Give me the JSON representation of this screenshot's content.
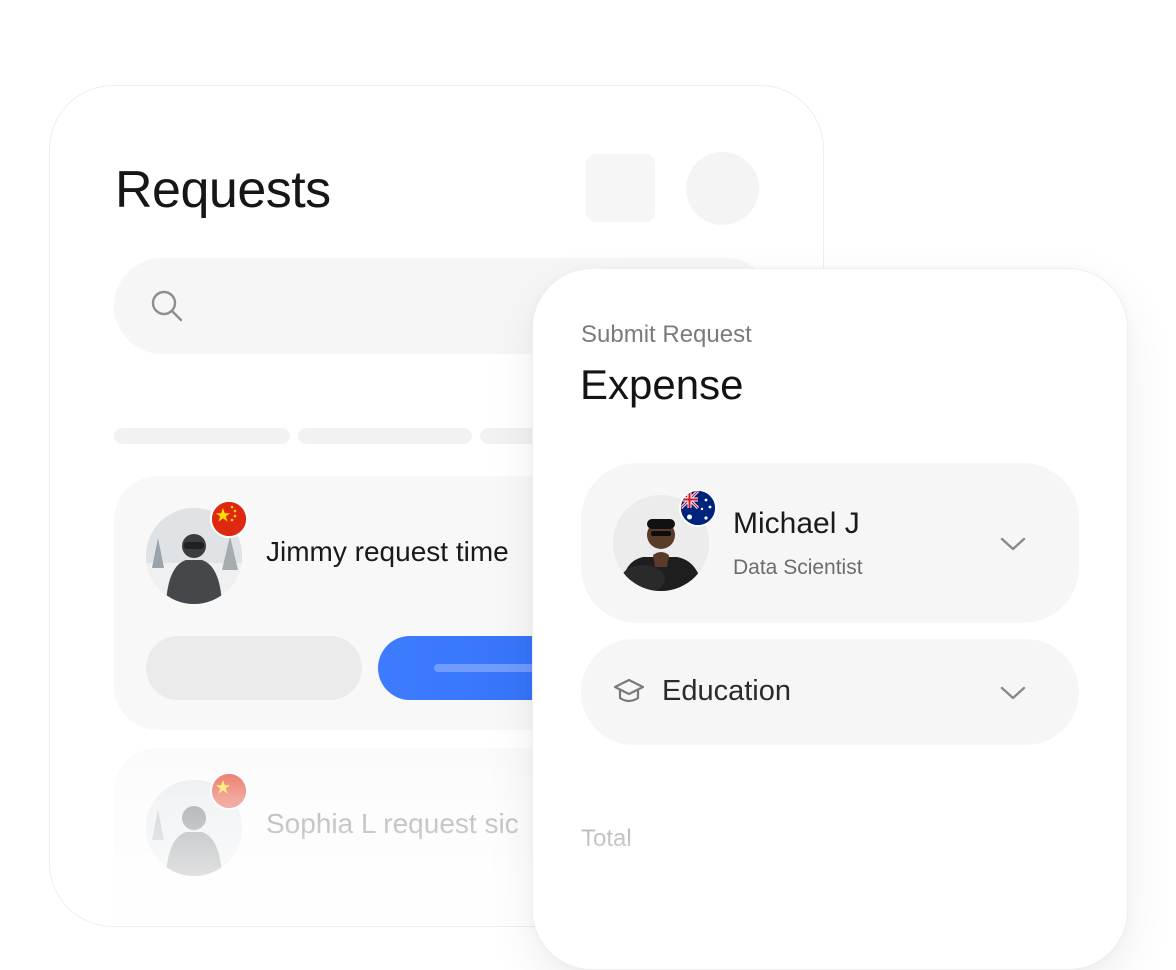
{
  "requests_panel": {
    "title": "Requests",
    "search": {
      "placeholder": "",
      "icon": "search-icon"
    },
    "items": [
      {
        "text": "Jimmy request time",
        "flag": "china-flag-icon"
      },
      {
        "text": "Sophia L request sic",
        "flag": "china-flag-icon"
      }
    ]
  },
  "submit_panel": {
    "subtitle": "Submit Request",
    "title": "Expense",
    "person": {
      "name": "Michael J",
      "role": "Data Scientist",
      "flag": "australia-flag-icon"
    },
    "category": {
      "label": "Education",
      "icon": "graduation-cap-icon"
    },
    "total_label": "Total"
  },
  "colors": {
    "accent": "#3d7bff",
    "card_bg": "#f6f6f6",
    "flag_red": "#de2910",
    "flag_blue": "#00247d"
  }
}
